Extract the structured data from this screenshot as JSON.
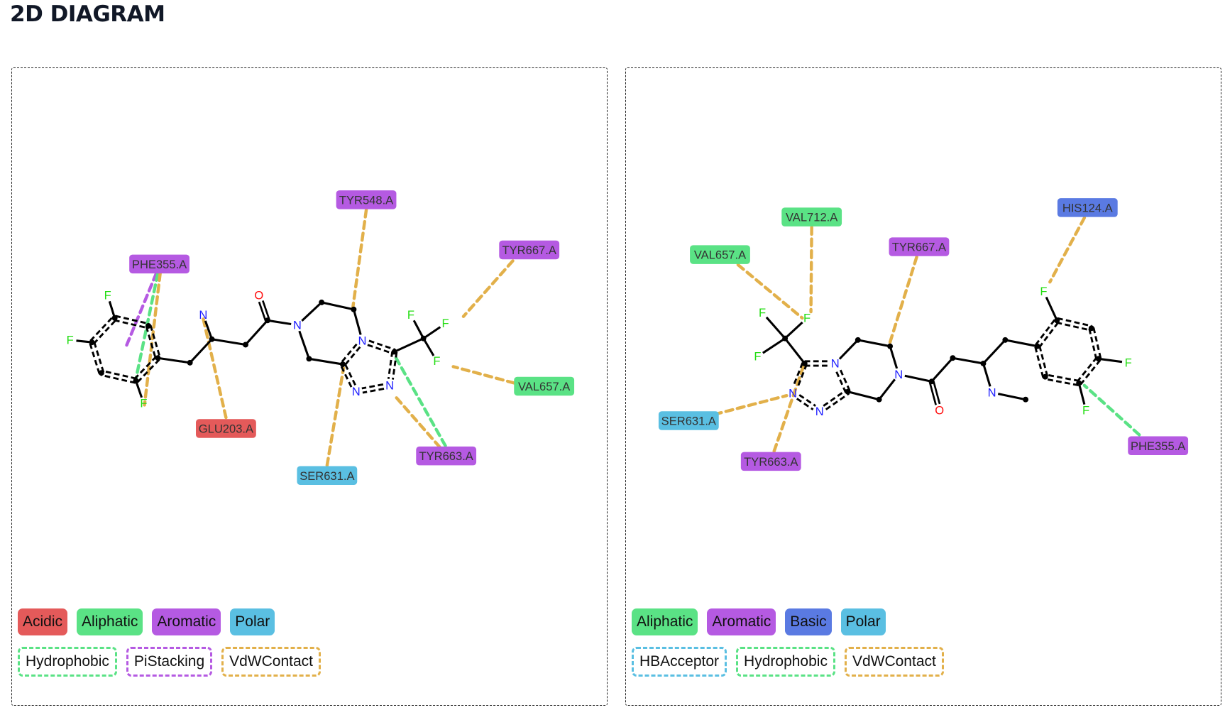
{
  "page": {
    "title": "2D DIAGRAM"
  },
  "colors": {
    "Acidic": "#e45a5a",
    "Aliphatic": "#5ae285",
    "Aromatic": "#b55ae2",
    "Basic": "#5a7ae2",
    "Polar": "#5abfe2",
    "Hydrophobic": "#5ae285",
    "PiStacking": "#b55ae2",
    "VdWContact": "#e2b04a",
    "HBAcceptor": "#5abfe2",
    "atom_N": "#2020ff",
    "atom_O": "#ff1010",
    "atom_F": "#22dd11",
    "bond": "#000000"
  },
  "panels": [
    {
      "id": "left",
      "residue_legend": [
        "Acidic",
        "Aliphatic",
        "Aromatic",
        "Polar"
      ],
      "interaction_legend": [
        "Hydrophobic",
        "PiStacking",
        "VdWContact"
      ],
      "residues": [
        {
          "name": "TYR548.A",
          "type": "Aromatic"
        },
        {
          "name": "PHE355.A",
          "type": "Aromatic"
        },
        {
          "name": "TYR667.A",
          "type": "Aromatic"
        },
        {
          "name": "VAL657.A",
          "type": "Aliphatic"
        },
        {
          "name": "GLU203.A",
          "type": "Acidic"
        },
        {
          "name": "TYR663.A",
          "type": "Aromatic"
        },
        {
          "name": "SER631.A",
          "type": "Polar"
        }
      ],
      "interactions": [
        {
          "residue": "TYR548.A",
          "type": "VdWContact"
        },
        {
          "residue": "PHE355.A",
          "type": "PiStacking"
        },
        {
          "residue": "PHE355.A",
          "type": "Hydrophobic"
        },
        {
          "residue": "PHE355.A",
          "type": "VdWContact"
        },
        {
          "residue": "TYR667.A",
          "type": "VdWContact"
        },
        {
          "residue": "VAL657.A",
          "type": "VdWContact"
        },
        {
          "residue": "GLU203.A",
          "type": "VdWContact"
        },
        {
          "residue": "TYR663.A",
          "type": "Hydrophobic"
        },
        {
          "residue": "TYR663.A",
          "type": "VdWContact"
        },
        {
          "residue": "SER631.A",
          "type": "VdWContact"
        }
      ]
    },
    {
      "id": "right",
      "residue_legend": [
        "Aliphatic",
        "Aromatic",
        "Basic",
        "Polar"
      ],
      "interaction_legend": [
        "HBAcceptor",
        "Hydrophobic",
        "VdWContact"
      ],
      "residues": [
        {
          "name": "VAL712.A",
          "type": "Aliphatic"
        },
        {
          "name": "VAL657.A",
          "type": "Aliphatic"
        },
        {
          "name": "TYR667.A",
          "type": "Aromatic"
        },
        {
          "name": "HIS124.A",
          "type": "Basic"
        },
        {
          "name": "SER631.A",
          "type": "Polar"
        },
        {
          "name": "TYR663.A",
          "type": "Aromatic"
        },
        {
          "name": "PHE355.A",
          "type": "Aromatic"
        }
      ],
      "interactions": [
        {
          "residue": "VAL712.A",
          "type": "VdWContact"
        },
        {
          "residue": "VAL657.A",
          "type": "VdWContact"
        },
        {
          "residue": "TYR667.A",
          "type": "VdWContact"
        },
        {
          "residue": "HIS124.A",
          "type": "VdWContact"
        },
        {
          "residue": "SER631.A",
          "type": "VdWContact"
        },
        {
          "residue": "TYR663.A",
          "type": "VdWContact"
        },
        {
          "residue": "PHE355.A",
          "type": "Hydrophobic"
        }
      ]
    }
  ]
}
